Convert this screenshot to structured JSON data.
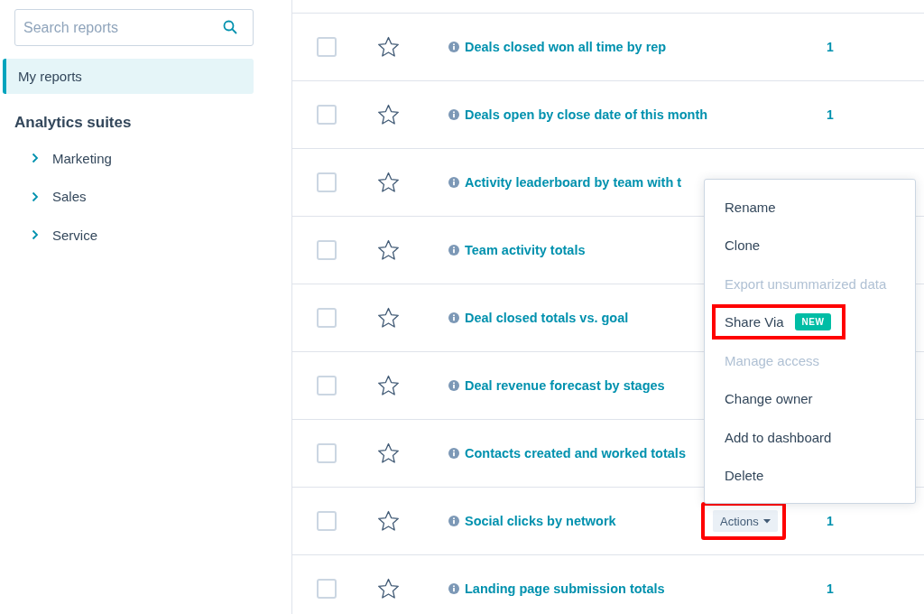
{
  "sidebar": {
    "search": {
      "placeholder": "Search reports"
    },
    "items": [
      {
        "label": "My reports",
        "selected": true
      }
    ],
    "section_title": "Analytics suites",
    "suites": [
      {
        "label": "Marketing",
        "expanded": false
      },
      {
        "label": "Sales",
        "expanded": false
      },
      {
        "label": "Service",
        "expanded": false
      }
    ]
  },
  "reports": [
    {
      "title": "Deals closed won all time by rep",
      "checked": false,
      "starred": false,
      "count": "1"
    },
    {
      "title": "Deals open by close date of this month",
      "checked": false,
      "starred": false,
      "count": "1"
    },
    {
      "title": "Activity leaderboard by team with t",
      "checked": false,
      "starred": false
    },
    {
      "title": "Team activity totals",
      "checked": false,
      "starred": false
    },
    {
      "title": "Deal closed totals vs. goal",
      "checked": false,
      "starred": false
    },
    {
      "title": "Deal revenue forecast by stages",
      "checked": false,
      "starred": false
    },
    {
      "title": "Contacts created and worked totals",
      "checked": false,
      "starred": false
    },
    {
      "title": "Social clicks by network",
      "checked": false,
      "starred": false,
      "actions": {
        "label": "Actions",
        "highlighted": true
      },
      "count": "1"
    },
    {
      "title": "Landing page submission totals",
      "checked": false,
      "starred": false,
      "count": "1"
    }
  ],
  "actions_menu": [
    {
      "label": "Rename",
      "disabled": false,
      "highlighted": false
    },
    {
      "label": "Clone",
      "disabled": false,
      "highlighted": false
    },
    {
      "label": "Export unsummarized data",
      "disabled": true,
      "highlighted": false
    },
    {
      "label": "Share Via",
      "disabled": false,
      "highlighted": true,
      "badge": "NEW"
    },
    {
      "label": "Manage access",
      "disabled": true,
      "highlighted": false
    },
    {
      "label": "Change owner",
      "disabled": false,
      "highlighted": false
    },
    {
      "label": "Add to dashboard",
      "disabled": false,
      "highlighted": false
    },
    {
      "label": "Delete",
      "disabled": false,
      "highlighted": false
    }
  ]
}
